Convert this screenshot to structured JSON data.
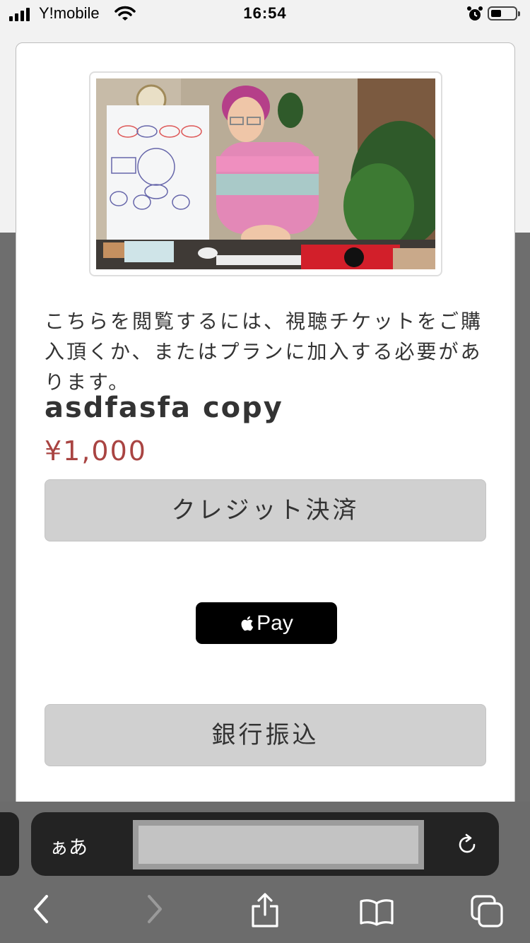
{
  "status_bar": {
    "carrier": "Y!mobile",
    "time": "16:54",
    "battery_level": 0.35
  },
  "modal": {
    "notice": "こちらを閲覧するには、視聴チケットをご購入頂くか、またはプランに加入する必要があります。",
    "product_title": "asdfasfa copy",
    "price": "¥1,000",
    "credit_button": "クレジット決済",
    "apple_pay_label": "Pay",
    "bank_button": "銀行振込",
    "price_color": "#a94442"
  },
  "toolbar": {
    "text_size_label": "ぁあ",
    "icons": [
      "back-icon",
      "forward-icon",
      "share-icon",
      "bookmarks-icon",
      "tabs-icon",
      "reload-icon"
    ]
  }
}
